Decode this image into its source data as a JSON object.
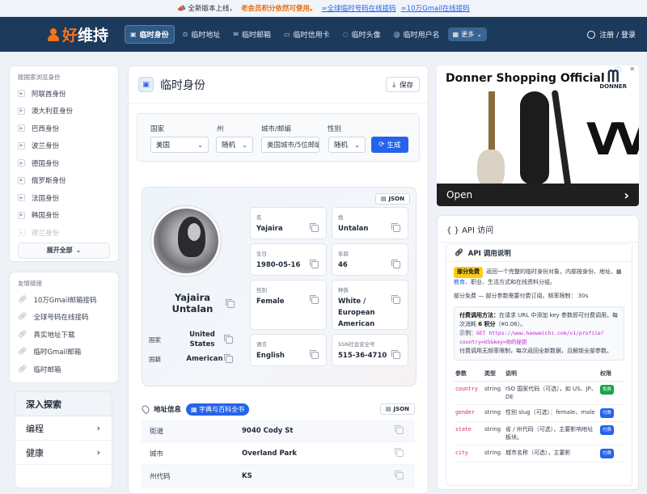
{
  "banner": {
    "prefix": "📣 全新版本上线，",
    "highlight": "老会员积分依然可使用。",
    "link1": "全球临时号码在线接码",
    "link2": "10万Gmail在线接码"
  },
  "header": {
    "logo_text_1": "好",
    "logo_text_2": "维持",
    "nav": [
      {
        "label": "临时身份",
        "icon": "id-card-icon",
        "active": true
      },
      {
        "label": "临时地址",
        "icon": "map-pin-icon",
        "active": false
      },
      {
        "label": "临时邮箱",
        "icon": "mail-icon",
        "active": false
      },
      {
        "label": "临时信用卡",
        "icon": "credit-card-icon",
        "active": false
      },
      {
        "label": "临时头像",
        "icon": "chat-bubble-icon",
        "active": false
      },
      {
        "label": "临时用户名",
        "icon": "at-icon",
        "active": false
      }
    ],
    "more_label": "更多",
    "login_label": "注册 / 登录"
  },
  "sidebar": {
    "country_title": "按国家浏览身份",
    "countries": [
      "阿联酋身份",
      "澳大利亚身份",
      "巴西身份",
      "波兰身份",
      "德国身份",
      "俄罗斯身份",
      "法国身份",
      "韩国身份",
      "荷兰身份"
    ],
    "expand_label": "展开全部",
    "links_title": "友情链接",
    "links": [
      "10万Gmail邮箱接码",
      "全球号码在线接码",
      "真实地址下载",
      "临时Gmail邮箱",
      "临时邮箱"
    ],
    "explore_title": "深入探索",
    "explore_items": [
      "编程",
      "健康"
    ]
  },
  "main": {
    "title": "临时身份",
    "save_label": "保存",
    "form": {
      "country_label": "国家",
      "country_value": "美国",
      "state_label": "州",
      "state_value": "随机",
      "city_label": "城市/邮编",
      "city_placeholder": "美国城市/5位邮编",
      "gender_label": "性别",
      "gender_value": "随机",
      "generate_label": "生成"
    },
    "json_label": "JSON",
    "profile": {
      "name_line1": "Yajaira",
      "name_line2": "Untalan",
      "country_label": "国家",
      "country_value_1": "United",
      "country_value_2": "States",
      "nationality_label": "国籍",
      "nationality_value": "American",
      "fields": [
        {
          "label": "名",
          "value": "Yajaira"
        },
        {
          "label": "姓",
          "value": "Untalan"
        },
        {
          "label": "生日",
          "value": "1980-05-16"
        },
        {
          "label": "年龄",
          "value": "46"
        },
        {
          "label": "性别",
          "value": "Female"
        },
        {
          "label": "种族",
          "value_1": "White /",
          "value_2": "European",
          "value_3": "American"
        },
        {
          "label": "语言",
          "value": "English"
        },
        {
          "label": "SSN社会安全号",
          "value": "515-36-4710"
        }
      ]
    },
    "address": {
      "title": "地址信息",
      "tag": "字典与百科全书",
      "json_label": "JSON",
      "rows": [
        {
          "key": "街道",
          "value": "9040 Cody St"
        },
        {
          "key": "城市",
          "value": "Overland Park"
        },
        {
          "key": "州代码",
          "value": "KS"
        }
      ]
    }
  },
  "ad": {
    "title": "Donner Shopping Official",
    "brand": "DONNER",
    "open_label": "Open"
  },
  "api": {
    "title": "{ } API 访问",
    "sub_title": "API 调用说明",
    "badge": "部分免费",
    "desc_1": "返回一个完整的临时身份对象，内部按身份、地址、",
    "desc_link": "教育",
    "desc_2": "、职业、生活方式和在线资料分组。",
    "rate": "部分免费 — 部分参数需要付费订阅。频率限制： 30s",
    "pay_title": "付费调用方法：",
    "pay_text_1": "在请求 URL 中添加 key 参数即可付费调用，每次消耗",
    "pay_points": "6 积分",
    "pay_text_2": "（¥0.06）。",
    "example_label": "示例：",
    "example_code": "GET https://www.haoweichi.com/v1/profile?country=US&key=你的秘钥",
    "pay_text_3": "付费调用无频率限制，每次返回全新数据，且解锁全部参数。",
    "table_headers": [
      "参数",
      "类型",
      "说明",
      "权限"
    ],
    "params": [
      {
        "name": "country",
        "type": "string",
        "desc": "ISO 国家代码（可选），如 US、JP、DE",
        "perm": "免费"
      },
      {
        "name": "gender",
        "type": "string",
        "desc": "性别 slug（可选）：female、male",
        "perm": "付费"
      },
      {
        "name": "state",
        "type": "string",
        "desc": "省 / 州代码（可选），主要影响地址板块。",
        "perm": "付费"
      },
      {
        "name": "city",
        "type": "string",
        "desc": "城市名称（可选），主要影",
        "perm": "付费"
      }
    ]
  }
}
